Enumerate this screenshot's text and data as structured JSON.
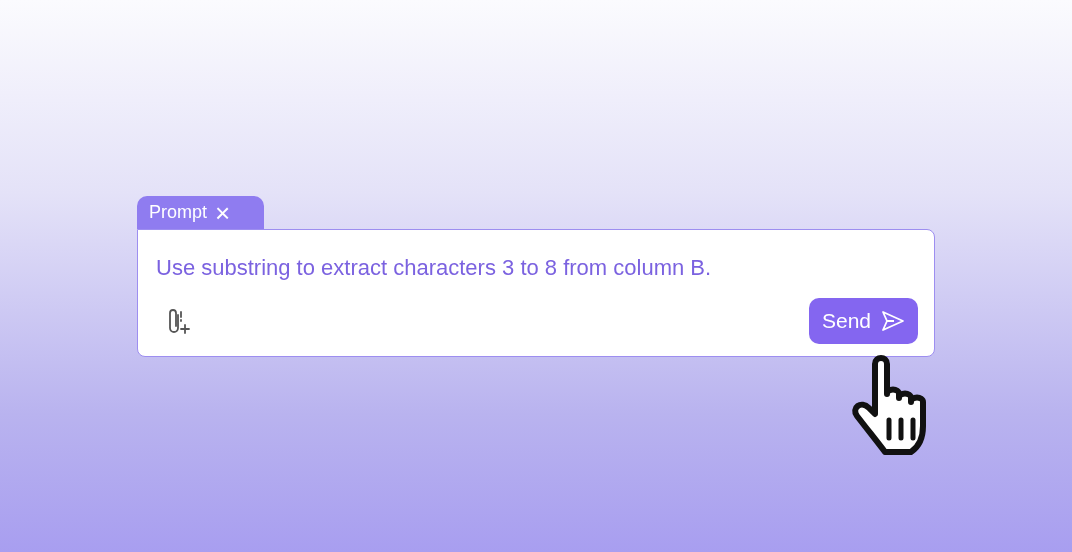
{
  "tab": {
    "label": "Prompt",
    "close": "×"
  },
  "prompt": {
    "value": "Use substring to extract characters 3 to 8 from column B."
  },
  "send_button": {
    "label": "Send"
  }
}
